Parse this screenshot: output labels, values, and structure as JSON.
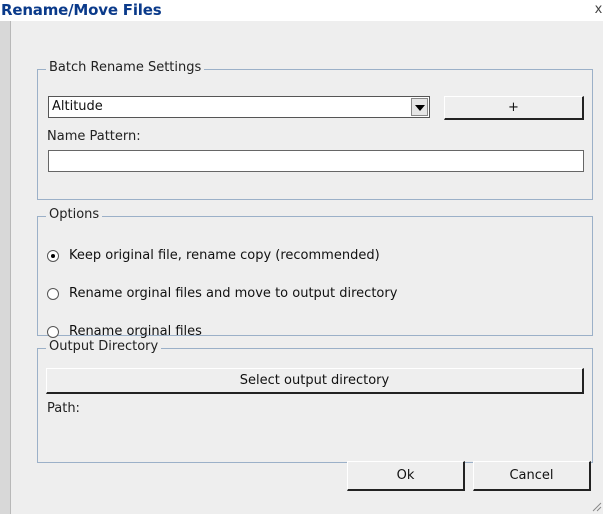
{
  "window": {
    "title": "Rename/Move Files",
    "close_glyph": "x"
  },
  "batch": {
    "legend": "Batch Rename Settings",
    "selected": "Altitude",
    "add_label": "+",
    "name_pattern_label": "Name Pattern:",
    "name_pattern_value": ""
  },
  "options": {
    "legend": "Options",
    "items": [
      {
        "label": "Keep original file, rename copy (recommended)",
        "checked": true
      },
      {
        "label": "Rename orginal files and move to output directory",
        "checked": false
      },
      {
        "label": "Rename orginal files",
        "checked": false
      }
    ]
  },
  "output": {
    "legend": "Output Directory",
    "select_label": "Select output directory",
    "path_label": "Path:",
    "path_value": ""
  },
  "footer": {
    "ok_label": "Ok",
    "cancel_label": "Cancel"
  }
}
